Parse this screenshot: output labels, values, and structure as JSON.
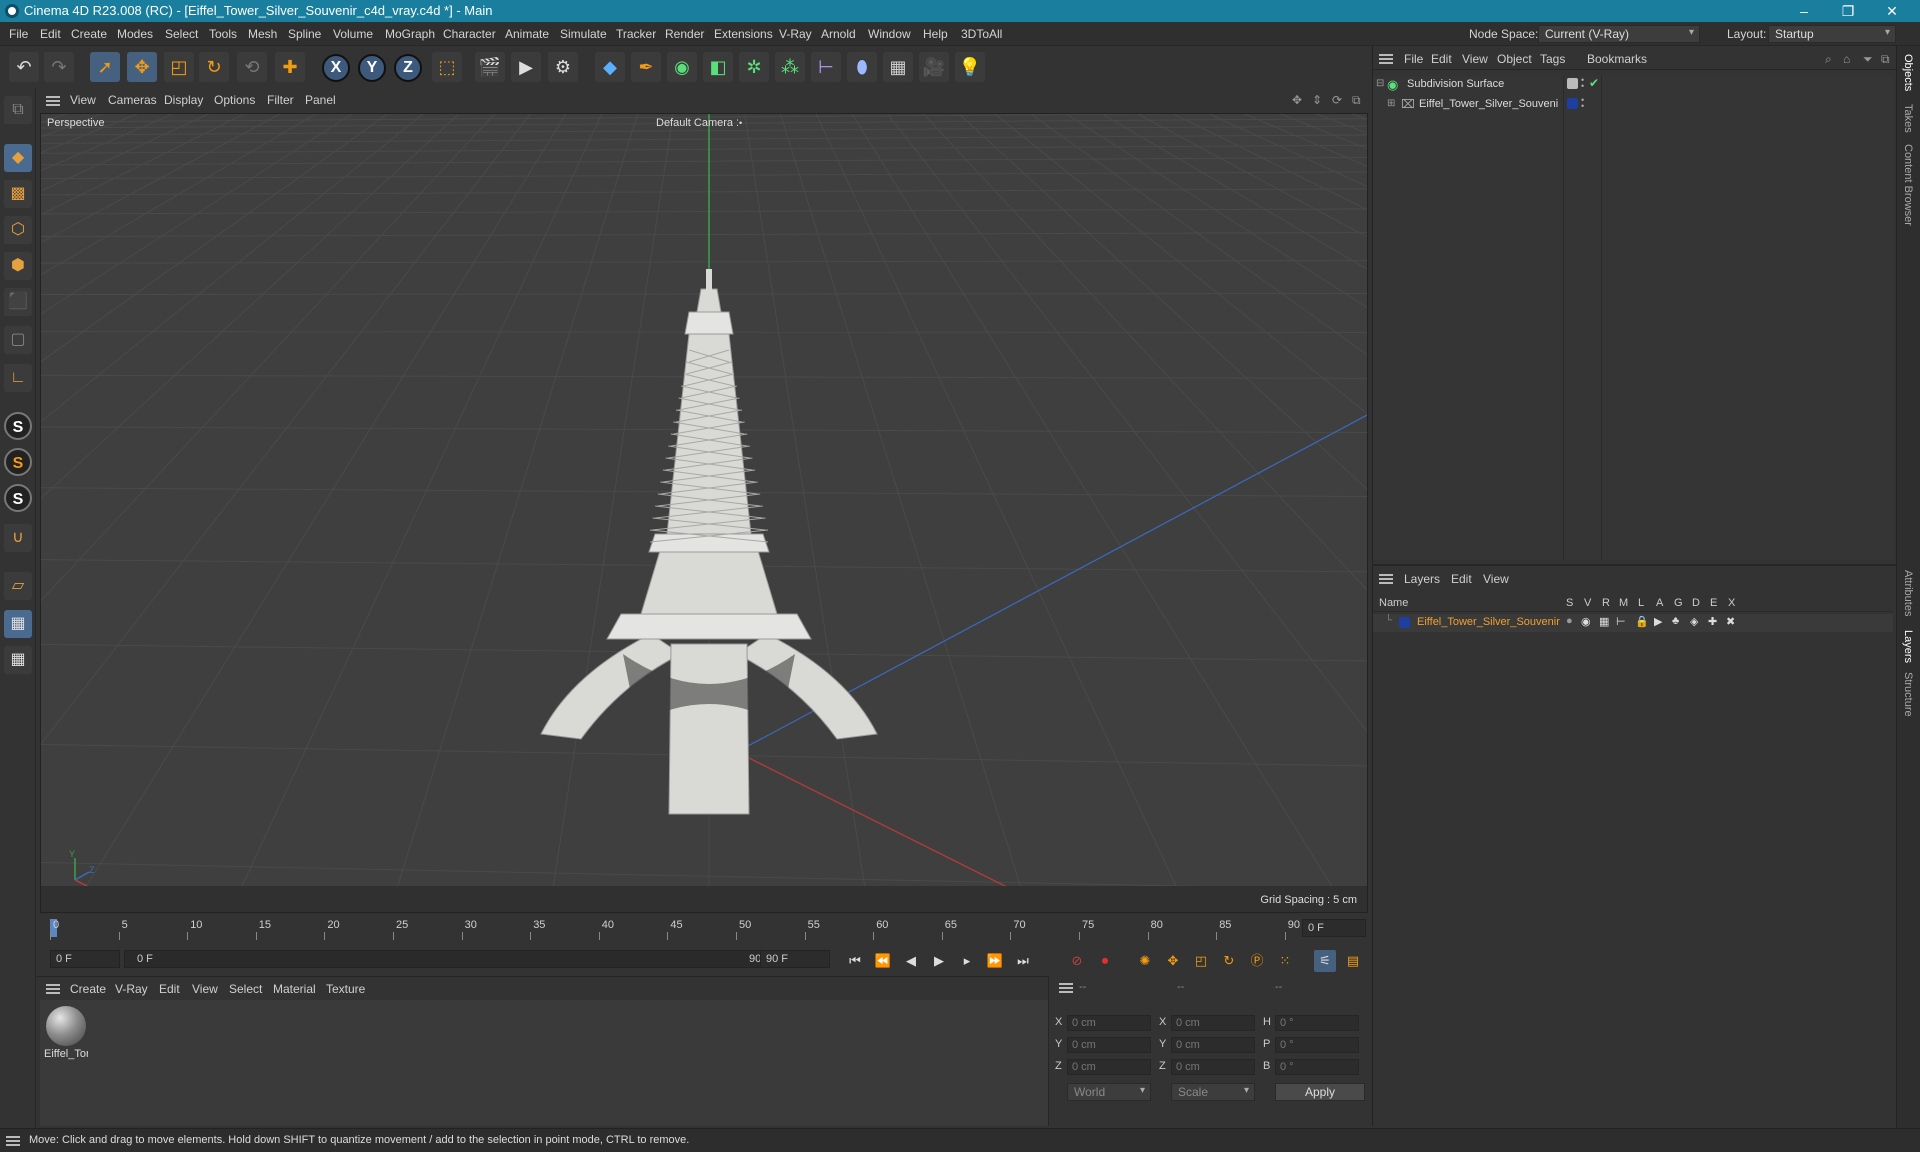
{
  "window": {
    "title": "Cinema 4D R23.008 (RC) - [Eiffel_Tower_Silver_Souvenir_c4d_vray.c4d *] - Main",
    "minimize": "–",
    "restore": "❐",
    "close": "✕"
  },
  "menubar": {
    "items": [
      "File",
      "Edit",
      "Create",
      "Modes",
      "Select",
      "Tools",
      "Mesh",
      "Spline",
      "Volume",
      "MoGraph",
      "Character",
      "Animate",
      "Simulate",
      "Tracker",
      "Render",
      "Extensions",
      "V-Ray",
      "Arnold",
      "Window",
      "Help",
      "3DToAll"
    ],
    "node_space_label": "Node Space:",
    "node_space_value": "Current (V-Ray)",
    "layout_label": "Layout:",
    "layout_value": "Startup"
  },
  "toolbar": {
    "axis_x": "X",
    "axis_y": "Y",
    "axis_z": "Z"
  },
  "viewport_menu": {
    "items": [
      "View",
      "Cameras",
      "Display",
      "Options",
      "Filter",
      "Panel"
    ]
  },
  "viewport": {
    "projection": "Perspective",
    "camera": "Default Camera",
    "camera_icon": "camera-dots-icon",
    "grid_spacing": "Grid Spacing : 5 cm",
    "colors": {
      "background": "#3f3f3f",
      "grid": "#4a4a4a",
      "x_axis": "#c03a3a",
      "y_axis": "#3aa04a",
      "z_axis": "#3a6ac0",
      "model": "#d9d9d6"
    },
    "axis_letters": {
      "x": "X",
      "y": "Y",
      "z": "Z"
    }
  },
  "timeline": {
    "ticks": [
      "0",
      "5",
      "10",
      "15",
      "20",
      "25",
      "30",
      "35",
      "40",
      "45",
      "50",
      "55",
      "60",
      "65",
      "70",
      "75",
      "80",
      "85",
      "90"
    ],
    "current_frame": "0 F"
  },
  "playbar": {
    "start_field": "0 F",
    "range_start": "0 F",
    "range_end": "90 F",
    "end_field": "90 F"
  },
  "material_menu": {
    "items": [
      "Create",
      "V-Ray",
      "Edit",
      "View",
      "Select",
      "Material",
      "Texture"
    ]
  },
  "materials": [
    {
      "name": "Eiffel_Tor"
    }
  ],
  "coords": {
    "header": [
      "--",
      "--",
      "--"
    ],
    "rows": [
      {
        "a_label": "X",
        "a_value": "0 cm",
        "b_label": "X",
        "b_value": "0 cm",
        "c_label": "H",
        "c_value": "0 °"
      },
      {
        "a_label": "Y",
        "a_value": "0 cm",
        "b_label": "Y",
        "b_value": "0 cm",
        "c_label": "P",
        "c_value": "0 °"
      },
      {
        "a_label": "Z",
        "a_value": "0 cm",
        "b_label": "Z",
        "b_value": "0 cm",
        "c_label": "B",
        "c_value": "0 °"
      }
    ],
    "space_value": "World",
    "mode_value": "Scale",
    "apply_label": "Apply"
  },
  "object_manager": {
    "menu": [
      "File",
      "Edit",
      "View",
      "Object",
      "Tags",
      "Bookmarks"
    ],
    "objects": [
      {
        "name": "Subdivision Surface"
      },
      {
        "name": "Eiffel_Tower_Silver_Souvenir"
      }
    ]
  },
  "layer_manager": {
    "menu": [
      "Layers",
      "Edit",
      "View"
    ],
    "columns": [
      "Name",
      "S",
      "V",
      "R",
      "M",
      "L",
      "A",
      "G",
      "D",
      "E",
      "X"
    ],
    "layers": [
      {
        "name": "Eiffel_Tower_Silver_Souvenir",
        "color": "#1f3fa0"
      }
    ]
  },
  "side_tabs": [
    "Objects",
    "Takes",
    "Content Browser",
    "Attributes",
    "Layers",
    "Structure"
  ],
  "status": {
    "message": "Move: Click and drag to move elements. Hold down SHIFT to quantize movement / add to the selection in point mode, CTRL to remove."
  }
}
